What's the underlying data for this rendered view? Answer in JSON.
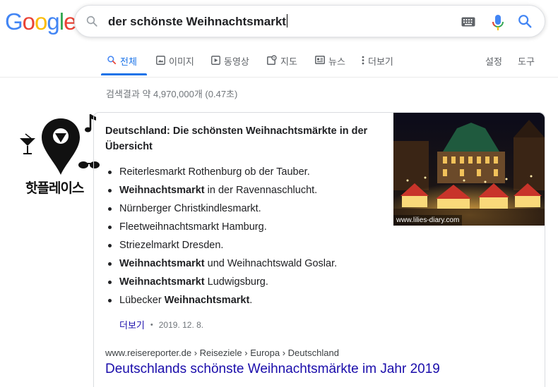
{
  "colors": {
    "google_blue": "#4285f4",
    "google_red": "#ea4335",
    "google_yellow": "#fbbc05",
    "google_green": "#34a853",
    "link": "#1a0dab",
    "tab_active": "#1a73e8"
  },
  "logo": {
    "letters": [
      "G",
      "o",
      "o",
      "g",
      "l",
      "e"
    ]
  },
  "search": {
    "query": "der schönste Weihnachtsmarkt",
    "icons": [
      "search-icon",
      "keyboard-icon",
      "microphone-icon",
      "search-submit-icon"
    ]
  },
  "tabs": [
    {
      "label": "전체",
      "icon": "search-icon",
      "active": true
    },
    {
      "label": "이미지",
      "icon": "image-icon",
      "active": false
    },
    {
      "label": "동영상",
      "icon": "video-icon",
      "active": false
    },
    {
      "label": "지도",
      "icon": "map-icon",
      "active": false
    },
    {
      "label": "뉴스",
      "icon": "news-icon",
      "active": false
    },
    {
      "label": "더보기",
      "icon": "more-vert-icon",
      "active": false
    },
    {
      "label": "설정",
      "active": false
    },
    {
      "label": "도구",
      "active": false
    }
  ],
  "stats": "검색결과 약 4,970,000개 (0.47초)",
  "side_logo": {
    "text": "핫플레이스"
  },
  "featured": {
    "title": "Deutschland: Die schönsten Weihnachtsmärkte in der Übersicht",
    "image_credit": "www.lilies-diary.com",
    "items": [
      {
        "pre": "Reiterlesmarkt Rothenburg ob der Tauber.",
        "bold": "",
        "post": ""
      },
      {
        "pre": "",
        "bold": "Weihnachtsmarkt",
        "post": " in der Ravennaschlucht."
      },
      {
        "pre": "Nürnberger Christkindlesmarkt.",
        "bold": "",
        "post": ""
      },
      {
        "pre": "Fleetweihnachtsmarkt Hamburg.",
        "bold": "",
        "post": ""
      },
      {
        "pre": "Striezelmarkt Dresden.",
        "bold": "",
        "post": ""
      },
      {
        "pre": "",
        "bold": "Weihnachtsmarkt",
        "post": " und Weihnachtswald Goslar."
      },
      {
        "pre": "",
        "bold": "Weihnachtsmarkt",
        "post": " Ludwigsburg."
      },
      {
        "pre": "Lübecker ",
        "bold": "Weihnachtsmarkt",
        "post": "."
      }
    ],
    "more_label": "더보기",
    "separator": "•",
    "date": "2019. 12. 8.",
    "breadcrumb": "www.reisereporter.de › Reiseziele › Europa › Deutschland",
    "result_title": "Deutschlands schönste Weihnachtsmärkte im Jahr 2019"
  }
}
